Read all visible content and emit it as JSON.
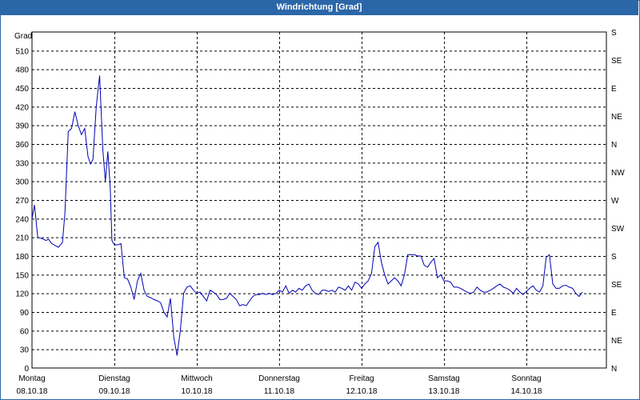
{
  "window": {
    "title": "Windrichtung [Grad]"
  },
  "chart_data": {
    "type": "line",
    "title": "Windrichtung [Grad]",
    "ylabel": "Grad",
    "ylim": [
      0,
      540
    ],
    "yticks": [
      0,
      30,
      60,
      90,
      120,
      150,
      180,
      210,
      240,
      270,
      300,
      330,
      360,
      390,
      420,
      450,
      480,
      510
    ],
    "right_axis_labels": [
      "N",
      "NE",
      "E",
      "SE",
      "S",
      "SW",
      "W",
      "NW",
      "N",
      "NE",
      "E",
      "SE",
      "S"
    ],
    "x_labels": [
      {
        "day": "Montag",
        "date": "08.10.18"
      },
      {
        "day": "Dienstag",
        "date": "09.10.18"
      },
      {
        "day": "Mittwoch",
        "date": "10.10.18"
      },
      {
        "day": "Donnerstag",
        "date": "11.10.18"
      },
      {
        "day": "Freitag",
        "date": "12.10.18"
      },
      {
        "day": "Samstag",
        "date": "13.10.18"
      },
      {
        "day": "Sonntag",
        "date": "14.10.18"
      }
    ],
    "x_range_days": [
      0,
      6.95
    ],
    "grid": true,
    "line_color": "#0000b4",
    "series": [
      {
        "values": [
          [
            0.0,
            240
          ],
          [
            0.03,
            262
          ],
          [
            0.07,
            210
          ],
          [
            0.12,
            208
          ],
          [
            0.17,
            205
          ],
          [
            0.2,
            207
          ],
          [
            0.24,
            200
          ],
          [
            0.28,
            197
          ],
          [
            0.32,
            194
          ],
          [
            0.37,
            202
          ],
          [
            0.4,
            250
          ],
          [
            0.44,
            380
          ],
          [
            0.48,
            385
          ],
          [
            0.52,
            412
          ],
          [
            0.56,
            390
          ],
          [
            0.6,
            375
          ],
          [
            0.64,
            385
          ],
          [
            0.68,
            340
          ],
          [
            0.71,
            328
          ],
          [
            0.74,
            335
          ],
          [
            0.78,
            420
          ],
          [
            0.82,
            470
          ],
          [
            0.86,
            350
          ],
          [
            0.89,
            300
          ],
          [
            0.92,
            348
          ],
          [
            0.95,
            290
          ],
          [
            0.97,
            205
          ],
          [
            1.0,
            198
          ],
          [
            1.04,
            198
          ],
          [
            1.08,
            200
          ],
          [
            1.12,
            145
          ],
          [
            1.16,
            143
          ],
          [
            1.2,
            130
          ],
          [
            1.24,
            110
          ],
          [
            1.28,
            140
          ],
          [
            1.32,
            152
          ],
          [
            1.36,
            125
          ],
          [
            1.4,
            115
          ],
          [
            1.44,
            113
          ],
          [
            1.48,
            110
          ],
          [
            1.52,
            108
          ],
          [
            1.56,
            105
          ],
          [
            1.6,
            90
          ],
          [
            1.64,
            82
          ],
          [
            1.68,
            112
          ],
          [
            1.72,
            50
          ],
          [
            1.76,
            20
          ],
          [
            1.8,
            60
          ],
          [
            1.84,
            120
          ],
          [
            1.88,
            130
          ],
          [
            1.92,
            132
          ],
          [
            1.96,
            125
          ],
          [
            2.0,
            120
          ],
          [
            2.04,
            122
          ],
          [
            2.08,
            115
          ],
          [
            2.12,
            108
          ],
          [
            2.16,
            125
          ],
          [
            2.2,
            122
          ],
          [
            2.24,
            118
          ],
          [
            2.28,
            110
          ],
          [
            2.32,
            110
          ],
          [
            2.36,
            112
          ],
          [
            2.4,
            120
          ],
          [
            2.44,
            115
          ],
          [
            2.48,
            110
          ],
          [
            2.52,
            100
          ],
          [
            2.56,
            102
          ],
          [
            2.6,
            100
          ],
          [
            2.64,
            108
          ],
          [
            2.68,
            115
          ],
          [
            2.72,
            118
          ],
          [
            2.76,
            118
          ],
          [
            2.8,
            120
          ],
          [
            2.84,
            118
          ],
          [
            2.88,
            120
          ],
          [
            2.92,
            118
          ],
          [
            2.96,
            120
          ],
          [
            3.0,
            125
          ],
          [
            3.04,
            122
          ],
          [
            3.08,
            132
          ],
          [
            3.12,
            120
          ],
          [
            3.16,
            125
          ],
          [
            3.2,
            122
          ],
          [
            3.24,
            128
          ],
          [
            3.28,
            125
          ],
          [
            3.32,
            132
          ],
          [
            3.36,
            135
          ],
          [
            3.4,
            125
          ],
          [
            3.44,
            120
          ],
          [
            3.48,
            118
          ],
          [
            3.52,
            125
          ],
          [
            3.56,
            125
          ],
          [
            3.6,
            123
          ],
          [
            3.64,
            125
          ],
          [
            3.68,
            122
          ],
          [
            3.72,
            130
          ],
          [
            3.76,
            128
          ],
          [
            3.8,
            125
          ],
          [
            3.84,
            132
          ],
          [
            3.88,
            125
          ],
          [
            3.92,
            138
          ],
          [
            3.96,
            135
          ],
          [
            4.0,
            128
          ],
          [
            4.04,
            135
          ],
          [
            4.08,
            140
          ],
          [
            4.12,
            152
          ],
          [
            4.16,
            195
          ],
          [
            4.2,
            202
          ],
          [
            4.24,
            170
          ],
          [
            4.28,
            150
          ],
          [
            4.32,
            135
          ],
          [
            4.36,
            140
          ],
          [
            4.4,
            145
          ],
          [
            4.44,
            140
          ],
          [
            4.48,
            132
          ],
          [
            4.52,
            150
          ],
          [
            4.56,
            182
          ],
          [
            4.6,
            182
          ],
          [
            4.64,
            182
          ],
          [
            4.68,
            180
          ],
          [
            4.72,
            180
          ],
          [
            4.76,
            165
          ],
          [
            4.8,
            162
          ],
          [
            4.84,
            170
          ],
          [
            4.88,
            176
          ],
          [
            4.92,
            145
          ],
          [
            4.96,
            150
          ],
          [
            5.0,
            140
          ],
          [
            5.04,
            140
          ],
          [
            5.08,
            138
          ],
          [
            5.12,
            130
          ],
          [
            5.16,
            130
          ],
          [
            5.2,
            128
          ],
          [
            5.24,
            125
          ],
          [
            5.28,
            122
          ],
          [
            5.32,
            120
          ],
          [
            5.36,
            122
          ],
          [
            5.4,
            130
          ],
          [
            5.44,
            125
          ],
          [
            5.48,
            122
          ],
          [
            5.52,
            122
          ],
          [
            5.56,
            125
          ],
          [
            5.6,
            128
          ],
          [
            5.64,
            132
          ],
          [
            5.68,
            135
          ],
          [
            5.72,
            130
          ],
          [
            5.76,
            128
          ],
          [
            5.8,
            125
          ],
          [
            5.84,
            120
          ],
          [
            5.88,
            128
          ],
          [
            5.92,
            122
          ],
          [
            5.96,
            118
          ],
          [
            6.0,
            123
          ],
          [
            6.04,
            128
          ],
          [
            6.08,
            132
          ],
          [
            6.12,
            125
          ],
          [
            6.16,
            122
          ],
          [
            6.2,
            132
          ],
          [
            6.24,
            178
          ],
          [
            6.28,
            182
          ],
          [
            6.32,
            135
          ],
          [
            6.36,
            128
          ],
          [
            6.4,
            128
          ],
          [
            6.44,
            132
          ],
          [
            6.48,
            133
          ],
          [
            6.52,
            130
          ],
          [
            6.56,
            128
          ],
          [
            6.6,
            120
          ],
          [
            6.64,
            115
          ],
          [
            6.68,
            122
          ]
        ]
      }
    ]
  }
}
